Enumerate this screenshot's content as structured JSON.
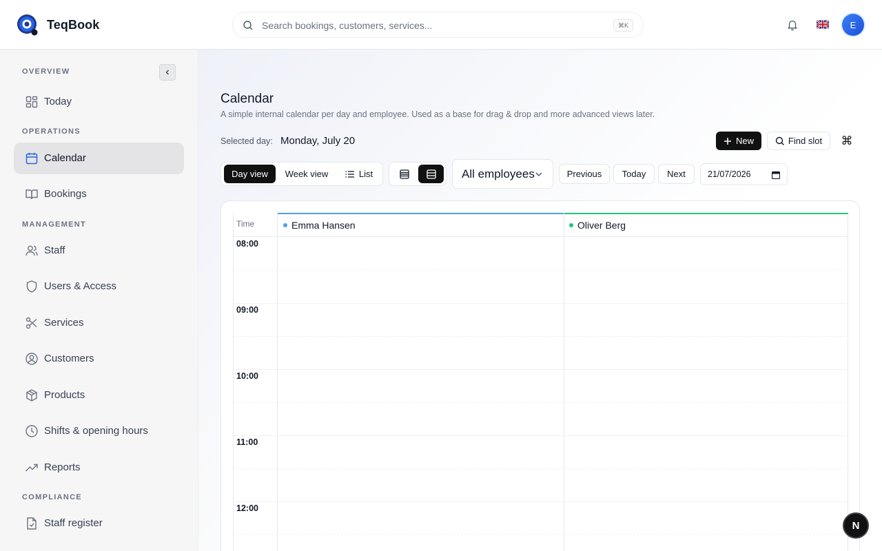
{
  "app": {
    "name": "TeqBook"
  },
  "search": {
    "placeholder": "Search bookings, customers, services...",
    "shortcut": "⌘K"
  },
  "user": {
    "avatar_initial": "E"
  },
  "sidebar": {
    "sections": {
      "overview": "OVERVIEW",
      "operations": "OPERATIONS",
      "management": "MANAGEMENT",
      "compliance": "COMPLIANCE"
    },
    "items": [
      {
        "label": "Today",
        "icon": "grid-icon"
      },
      {
        "label": "Calendar",
        "icon": "calendar-icon",
        "active": true
      },
      {
        "label": "Bookings",
        "icon": "book-icon"
      },
      {
        "label": "Staff",
        "icon": "users-icon"
      },
      {
        "label": "Users & Access",
        "icon": "shield-icon"
      },
      {
        "label": "Services",
        "icon": "scissors-icon"
      },
      {
        "label": "Customers",
        "icon": "user-circle-icon"
      },
      {
        "label": "Products",
        "icon": "box-icon"
      },
      {
        "label": "Shifts & opening hours",
        "icon": "clock-icon"
      },
      {
        "label": "Reports",
        "icon": "trend-icon"
      },
      {
        "label": "Staff register",
        "icon": "file-check-icon"
      }
    ]
  },
  "page": {
    "title": "Calendar",
    "subtitle": "A simple internal calendar per day and employee. Used as a base for drag & drop and more advanced views later.",
    "selected_day_label": "Selected day:",
    "selected_day_value": "Monday, July 20"
  },
  "toolbar": {
    "new_label": "New",
    "find_slot_label": "Find slot",
    "views": {
      "day": "Day view",
      "week": "Week view",
      "list": "List",
      "active": "day"
    },
    "employee_filter": "All employees",
    "previous": "Previous",
    "today": "Today",
    "next": "Next",
    "date_value": "21/07/2026"
  },
  "calendar": {
    "time_header": "Time",
    "employees": [
      {
        "name": "Emma Hansen",
        "color": "#4f9fe8"
      },
      {
        "name": "Oliver Berg",
        "color": "#22c27a"
      }
    ],
    "hours": [
      "08:00",
      "09:00",
      "10:00",
      "11:00",
      "12:00"
    ]
  },
  "badge": {
    "label": "N"
  }
}
